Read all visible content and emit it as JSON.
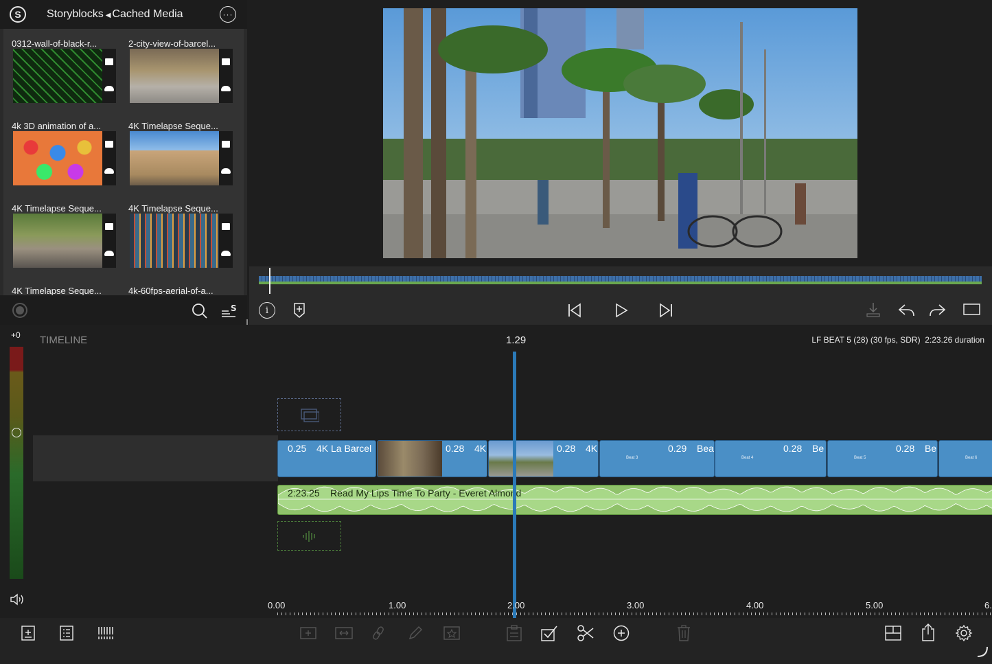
{
  "media_browser": {
    "source_label": "Storyblocks",
    "folder_label": "Cached Media",
    "items": [
      {
        "title": "0312-wall-of-black-r..."
      },
      {
        "title": "2-city-view-of-barcel..."
      },
      {
        "title": "4k 3D animation of a..."
      },
      {
        "title": "4K Timelapse Seque..."
      },
      {
        "title": "4K Timelapse Seque..."
      },
      {
        "title": "4K Timelapse Seque..."
      },
      {
        "title": "4K Timelapse Seque..."
      },
      {
        "title": "4k-60fps-aerial-of-a..."
      }
    ]
  },
  "timeline": {
    "heading": "TIMELINE",
    "playhead_time": "1.29",
    "project_info": "LF BEAT 5 (28) (30 fps, SDR)  2:23.26 duration",
    "meter_level": "+0",
    "video_clips": [
      {
        "duration": "0.25",
        "name": "4K La Barcel"
      },
      {
        "duration": "0.28",
        "name": "4K"
      },
      {
        "duration": "0.28",
        "name": "4K"
      },
      {
        "duration": "0.29",
        "name": "Bea",
        "marker": "Beat 3"
      },
      {
        "duration": "0.28",
        "name": "Be",
        "marker": "Beat 4"
      },
      {
        "duration": "0.28",
        "name": "Be",
        "marker": "Beat 5"
      },
      {
        "marker": "Beat 6"
      }
    ],
    "audio_clip": {
      "duration": "2:23.25",
      "name": "Read My Lips Time To Party - Everet Almond"
    },
    "ruler": [
      "0.00",
      "1.00",
      "2.00",
      "3.00",
      "4.00",
      "5.00",
      "6."
    ]
  },
  "colors": {
    "video_clip": "#4a8fc6",
    "audio_clip": "#8fc26a",
    "playhead": "#2b7ab8",
    "scrub_bar": "#3d6fa8",
    "scrub_green": "#6aa84f"
  }
}
